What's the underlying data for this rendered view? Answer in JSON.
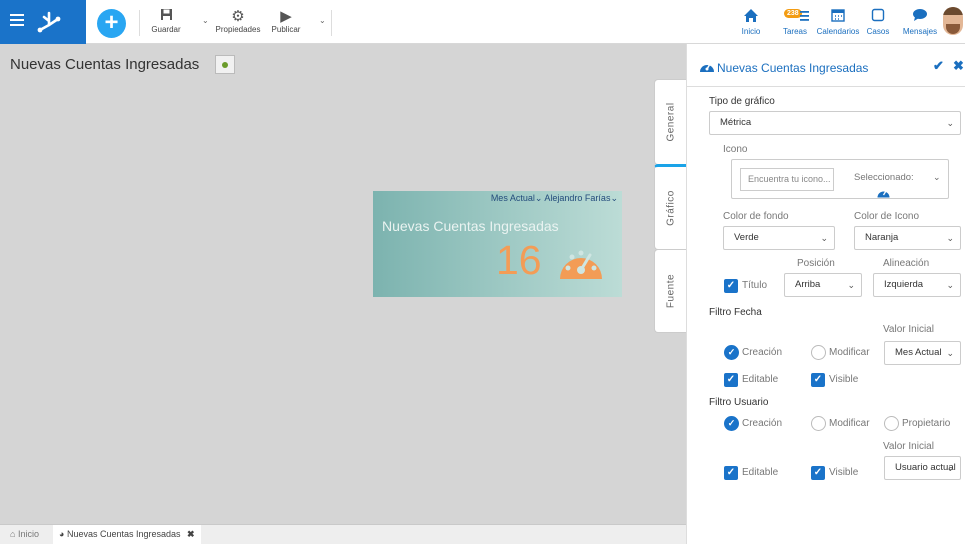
{
  "toolbar": {
    "save_label": "Guardar",
    "properties_label": "Propiedades",
    "publish_label": "Publicar"
  },
  "nav": {
    "home_label": "Inicio",
    "tasks_label": "Tareas",
    "tasks_badge": "238",
    "calendars_label": "Calendarios",
    "cases_label": "Casos",
    "messages_label": "Mensajes"
  },
  "canvas": {
    "page_title": "Nuevas Cuentas Ingresadas",
    "widget": {
      "date_filter": "Mes Actual",
      "user_filter": "Alejandro Farías",
      "title": "Nuevas Cuentas Ingresadas",
      "value": "16"
    },
    "vertical_tabs": [
      "General",
      "Gráfico",
      "Fuente"
    ]
  },
  "bottom_tabs": {
    "home": "Inicio",
    "document": "Nuevas Cuentas Ingresadas"
  },
  "panel": {
    "title": "Nuevas Cuentas Ingresadas",
    "chart_type_label": "Tipo de gráfico",
    "chart_type_value": "Métrica",
    "icon_label": "Icono",
    "icon_search_placeholder": "Encuentra tu icono...",
    "icon_selected_label": "Seleccionado:",
    "bg_color_label": "Color de fondo",
    "bg_color_value": "Verde",
    "icon_color_label": "Color de Icono",
    "icon_color_value": "Naranja",
    "position_label": "Posición",
    "alignment_label": "Alineación",
    "title_checkbox_label": "Título",
    "position_value": "Arriba",
    "alignment_value": "Izquierda",
    "date_filter_header": "Filtro Fecha",
    "date_initial_value_label": "Valor Inicial",
    "date_creation": "Creación",
    "date_modify": "Modificar",
    "date_initial_value": "Mes Actual",
    "date_editable": "Editable",
    "date_visible": "Visible",
    "user_filter_header": "Filtro Usuario",
    "user_creation": "Creación",
    "user_modify": "Modificar",
    "user_owner": "Propietario",
    "user_initial_value_label": "Valor Inicial",
    "user_editable": "Editable",
    "user_visible": "Visible",
    "user_initial_value": "Usuario actual"
  },
  "colors": {
    "brand": "#1a73c9",
    "accent": "#29a6f2",
    "badge": "#f39c12",
    "metric_orange": "#f39c56"
  }
}
